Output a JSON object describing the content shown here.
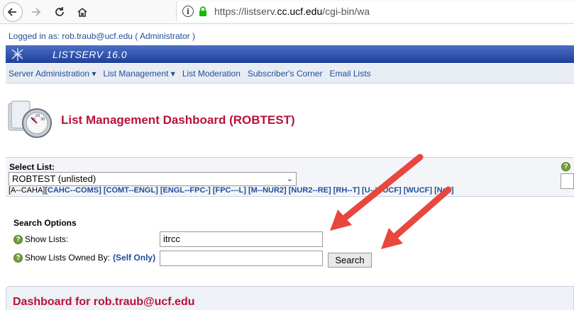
{
  "browser": {
    "url_prefix": "https://listserv.",
    "url_domain": "cc.ucf.edu",
    "url_path": "/cgi-bin/wa",
    "info_symbol": "i"
  },
  "page": {
    "logged_in": "Logged in as: rob.traub@ucf.edu ( Administrator )",
    "app_title": "LISTSERV 16.0",
    "menu": [
      "Server Administration ▾",
      "List Management ▾",
      "List Moderation",
      "Subscriber's Corner",
      "Email Lists"
    ],
    "dashboard_title": "List Management Dashboard (ROBTEST)",
    "select_list": {
      "label": "Select List:",
      "value": "ROBTEST (unlisted)",
      "ranges": [
        "[A--CAHA]",
        "[CAHC--COMS]",
        "[COMT--ENGL]",
        "[ENGL--FPC-]",
        "[FPC---L]",
        "[M--NUR2]",
        "[NUR2--RE]",
        "[RH--T]",
        "[U--WUCF]",
        "[WUCF]",
        "[Ne..]"
      ]
    },
    "search": {
      "title": "Search Options",
      "show_lists_label": "Show Lists:",
      "show_lists_value": "itrcc",
      "owned_by_label": "Show Lists Owned By:",
      "self_only": "(Self Only)",
      "search_button": "Search",
      "help_symbol": "?"
    },
    "dashboard_for": "Dashboard for rob.traub@ucf.edu"
  },
  "colors": {
    "accent_red": "#b8123a",
    "link_blue": "#1f4d98",
    "banner_blue": "#1d3f99",
    "arrow_red": "#e8473f"
  }
}
